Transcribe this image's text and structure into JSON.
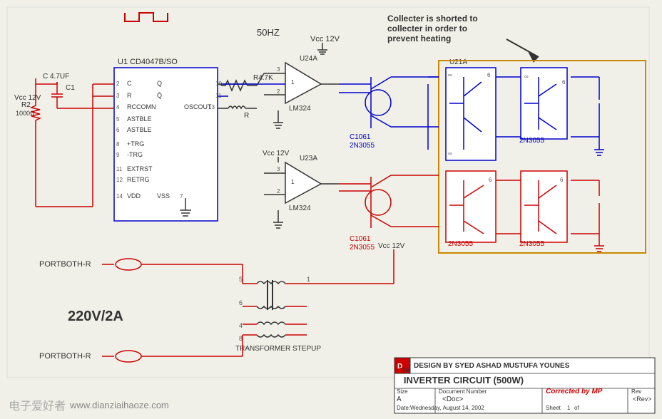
{
  "title": "Inverter Circuit 500W",
  "annotation": {
    "line1": "Collecter is shorted to",
    "line2": "collecter in order to",
    "line3": "prevent heating"
  },
  "labels": {
    "frequency": "50HZ",
    "voltage_vcc": "Vcc 12V",
    "ic_u1": "U1   CD4047B/SO",
    "op_u24a": "U24A",
    "op_u23a": "U23A",
    "lm324_1": "LM324",
    "lm324_2": "LM324",
    "c1061_1": "C1061",
    "c1061_2": "C1061",
    "transistor_u21a": "U21A",
    "r4k7": "R4.7K",
    "cap_c1": "C 4.7UF",
    "cap_label": "C1",
    "r2_label": "R2",
    "r2_value": "1000Ω",
    "vcc_12v_1": "Vcc 12V",
    "vcc_12v_2": "Vcc 12V",
    "vcc_12v_3": "Vcc 12V",
    "vcc_label_main": "Vcc 12V",
    "power_220v": "220V/2A",
    "transformer": "TRANSFORMER STEPUP",
    "portboth_r1": "PORTBOTH-R",
    "portboth_r2": "PORTBOTH-R",
    "oscout": "OSCOUT",
    "pins": {
      "c": "C",
      "r": "R",
      "rccomn": "RCCOMN",
      "q": "Q",
      "astble1": "ASTBLE",
      "astble2": "ASTBLE",
      "trg_pos": "+TRG",
      "trg_neg": "-TRG",
      "extrst": "EXTRST",
      "retrg": "RETRG",
      "vdd": "VDD",
      "vss": "VSS",
      "r_pin": "R",
      "pin13": "13",
      "pin14": "14",
      "pin7": "7"
    },
    "2n3055_labels": [
      "2N3055",
      "2N3055",
      "2N3055",
      "2N3055"
    ],
    "title_block": {
      "design_by": "DESIGN BY SYED ASHAD MUSTUFA YOUNES",
      "title": "INVERTER CIRCUIT (500W)",
      "size": "Size",
      "size_val": "A",
      "doc_number": "Document Number",
      "doc_val": "<Doc>",
      "rev": "Rev",
      "rev_val": "<Rev>",
      "date_label": "Date:",
      "date_val": "Wednesday, August 14, 2002",
      "sheet_label": "Sheet",
      "sheet_val": "1",
      "of_label": "of",
      "corrected": "Corrected by MP"
    }
  },
  "watermark": {
    "symbol": "电子爱好者",
    "url": "www.dianziaihaoze.com"
  }
}
